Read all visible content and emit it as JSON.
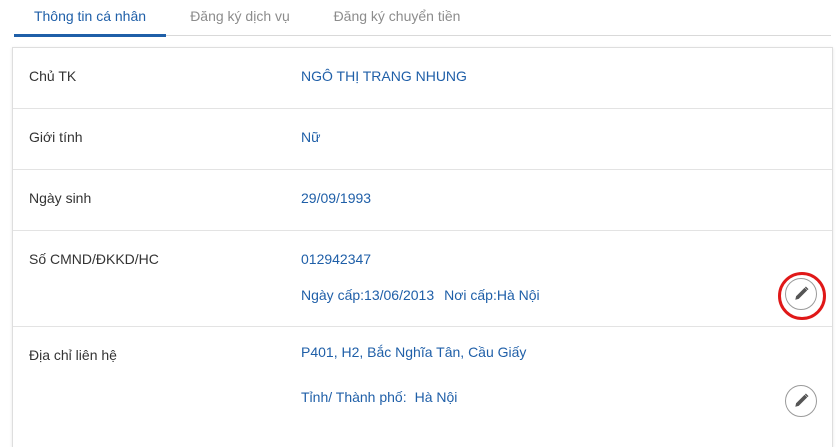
{
  "tabs": [
    {
      "label": "Thông tin cá nhân",
      "active": true
    },
    {
      "label": "Đăng ký dịch vụ",
      "active": false
    },
    {
      "label": "Đăng ký chuyển tiền",
      "active": false
    }
  ],
  "info": {
    "account_holder": {
      "label": "Chủ TK",
      "value": "NGÔ THỊ TRANG NHUNG"
    },
    "gender": {
      "label": "Giới tính",
      "value": "Nữ"
    },
    "birth_date": {
      "label": "Ngày sinh",
      "value": "29/09/1993"
    },
    "id_document": {
      "label": "Số CMND/ĐKKD/HC",
      "number": "012942347",
      "issue_date": "Ngày cấp:13/06/2013",
      "issue_place": "Nơi cấp:Hà Nội"
    },
    "address": {
      "label": "Địa chỉ liên hệ",
      "street": "P401, H2, Bắc Nghĩa Tân, Cầu Giấy",
      "province_label": "Tỉnh/ Thành phố:",
      "province_value": "Hà Nội"
    }
  },
  "colors": {
    "accent": "#1f5fa8",
    "highlight": "#e01818"
  },
  "icons": {
    "edit": "pencil-icon"
  }
}
